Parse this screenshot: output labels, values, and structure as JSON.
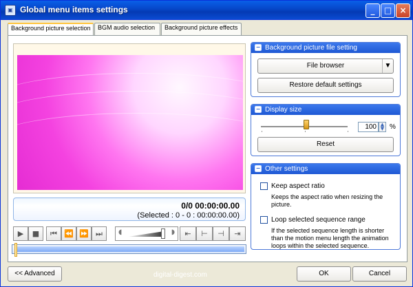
{
  "window": {
    "title": "Global menu items settings",
    "icon": "app-logo-icon",
    "controls": [
      "_",
      "□",
      "×"
    ]
  },
  "tabs": [
    {
      "label": "Background picture selection",
      "active": true
    },
    {
      "label": "BGM audio selection",
      "active": false
    },
    {
      "label": "Background picture effects",
      "active": false
    }
  ],
  "time_display": {
    "main": "0/0  00:00:00.00",
    "selected": "(Selected : 0 - 0 : 00:00:00.00)"
  },
  "transport": {
    "play_icon": "play-icon",
    "stop_icon": "stop-icon",
    "prev_frame_icon": "previous-frame-icon",
    "rewind_icon": "rewind-icon",
    "fast_forward_icon": "fast-forward-icon",
    "next_frame_icon": "next-frame-icon",
    "marker_icons": [
      "go-start-icon",
      "mark-in-icon",
      "mark-out-icon",
      "go-end-icon"
    ]
  },
  "right_panel": {
    "file_setting": {
      "title": "Background picture file setting",
      "file_browser": "File browser",
      "restore": "Restore default settings"
    },
    "display_size": {
      "title": "Display size",
      "value": "100",
      "unit": "%",
      "reset": "Reset"
    },
    "other_settings": {
      "title": "Other settings",
      "keep_aspect": "Keep aspect ratio",
      "keep_aspect_desc_1": "Keeps the aspect ratio when resizing the",
      "keep_aspect_desc_2": "picture.",
      "loop_range": "Loop selected sequence range",
      "loop_desc_1": "If the selected sequence length is shorter",
      "loop_desc_2": "than the motion menu length the animation",
      "loop_desc_3": "loops within the selected sequence."
    }
  },
  "bottom": {
    "advanced": "<< Advanced",
    "watermark": "digital-digest.com",
    "ok": "OK",
    "cancel": "Cancel"
  },
  "colors": {
    "title_blue": "#0646c8",
    "panel_blue": "#1e58d4",
    "preview_pink": "#f442e0"
  }
}
